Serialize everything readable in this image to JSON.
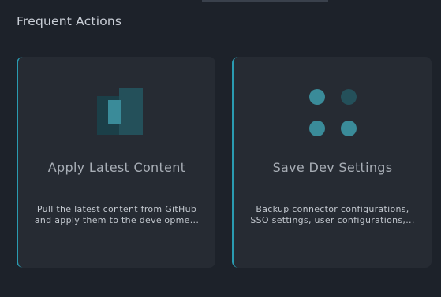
{
  "section": {
    "title": "Frequent Actions"
  },
  "cards": [
    {
      "title": "Apply Latest Content",
      "description_line1": "Pull the latest content from GitHub",
      "description_line2": "and apply them to the developme..."
    },
    {
      "title": "Save Dev Settings",
      "description_line1": "Backup connector configurations,",
      "description_line2": "SSO settings, user configurations,..."
    }
  ],
  "colors": {
    "accent": "#2a9bb1",
    "icon_teal_light": "#3a8b99",
    "icon_teal_dark": "#25505a"
  },
  "icons": {
    "apply": "apply-content-icon",
    "save": "save-settings-icon"
  }
}
